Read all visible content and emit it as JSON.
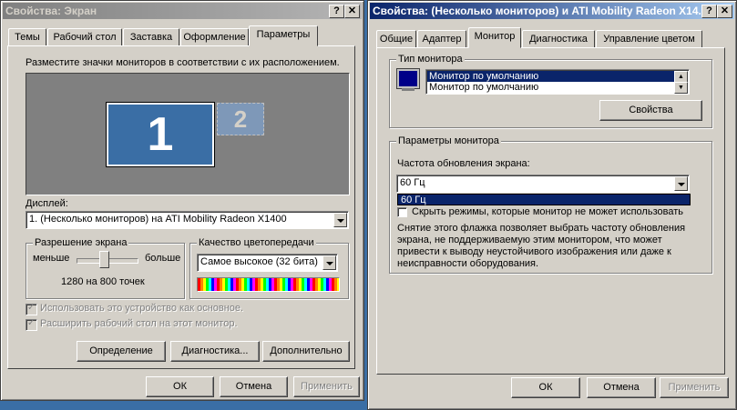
{
  "left": {
    "title": "Свойства: Экран",
    "tabs": [
      "Темы",
      "Рабочий стол",
      "Заставка",
      "Оформление",
      "Параметры"
    ],
    "instruction": "Разместите значки мониторов в соответствии с их расположением.",
    "monitor1": "1",
    "monitor2": "2",
    "display_label": "Дисплей:",
    "display_value": "1. (Несколько мониторов) на ATI Mobility Radeon X1400",
    "resolution": {
      "label": "Разрешение экрана",
      "less": "меньше",
      "more": "больше",
      "value": "1280 на 800 точек"
    },
    "color_quality": {
      "label": "Качество цветопередачи",
      "value": "Самое высокое (32 бита)"
    },
    "checks": [
      "Использовать это устройство как основное.",
      "Расширить рабочий стол на этот монитор."
    ],
    "buttons": {
      "identify": "Определение",
      "troubleshoot": "Диагностика...",
      "advanced": "Дополнительно",
      "ok": "ОК",
      "cancel": "Отмена",
      "apply": "Применить"
    }
  },
  "right": {
    "title": "Свойства: (Несколько мониторов) и ATI Mobility Radeon X14...",
    "tabs": [
      "Общие",
      "Адаптер",
      "Монитор",
      "Диагностика",
      "Управление цветом"
    ],
    "monitor_type": {
      "label": "Тип монитора",
      "items": [
        "Монитор по умолчанию",
        "Монитор по умолчанию"
      ],
      "properties_button": "Свойства"
    },
    "monitor_settings": {
      "label": "Параметры монитора",
      "refresh_label": "Частота обновления экрана:",
      "refresh_value": "60 Гц",
      "refresh_option": "60 Гц",
      "hide_modes": "Скрыть режимы, которые монитор не может использовать",
      "description": [
        "Снятие этого флажка позволяет выбрать частоту обновления",
        "экрана, не поддерживаемую этим монитором, что может",
        "привести к выводу неустойчивого изображения или даже к",
        "неисправности оборудования."
      ]
    },
    "buttons": {
      "ok": "ОК",
      "cancel": "Отмена",
      "apply": "Применить"
    }
  }
}
